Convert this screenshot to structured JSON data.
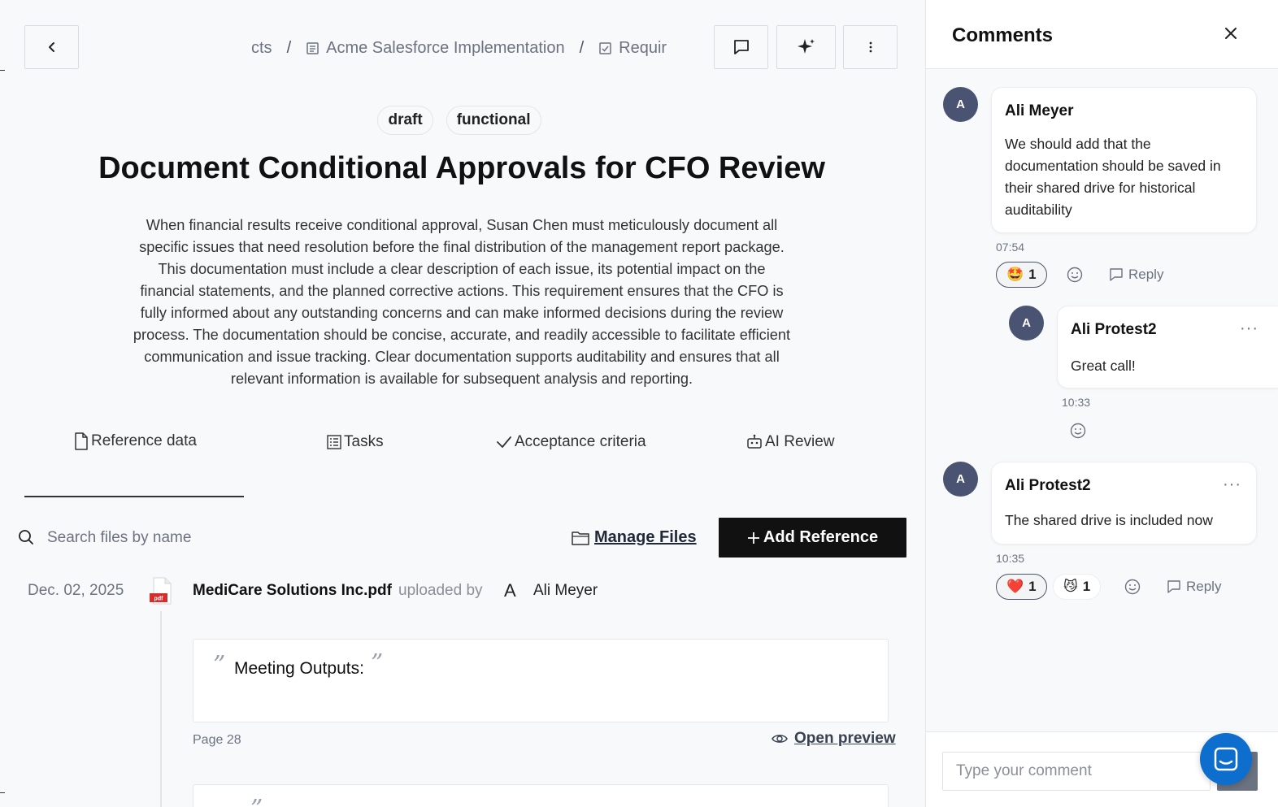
{
  "breadcrumb": {
    "items": [
      "cts",
      "Acme Salesforce Implementation",
      "Requir"
    ],
    "separator": "/"
  },
  "tags": [
    "draft",
    "functional"
  ],
  "requirement": {
    "title": "Document Conditional Approvals for CFO Review",
    "description": "When financial results receive conditional approval, Susan Chen must meticulously document all specific issues that need resolution before the final distribution of the management report package. This documentation must include a clear description of each issue, its potential impact on the financial statements, and the planned corrective actions. This requirement ensures that the CFO is fully informed about any outstanding concerns and can make informed decisions during the review process. The documentation should be concise, accurate, and readily accessible to facilitate efficient communication and issue tracking. Clear documentation supports auditability and ensures that all relevant information is available for subsequent analysis and reporting."
  },
  "tabs": {
    "reference": "Reference data",
    "tasks": "Tasks",
    "acceptance": "Acceptance criteria",
    "ai_review": "AI Review",
    "active": "reference"
  },
  "files": {
    "search_placeholder": "Search files by name",
    "manage_label": "Manage Files",
    "add_label": "Add Reference",
    "entry": {
      "date": "Dec. 02, 2025",
      "icon_label": "pdf",
      "name": "MediCare Solutions Inc.pdf",
      "uploaded_by_label": "uploaded by",
      "uploader_initial": "A",
      "uploader_name": "Ali Meyer"
    },
    "quote": {
      "open_mark": "”",
      "close_mark": "”",
      "text": "Meeting Outputs:",
      "page": "Page 28",
      "preview_label": "Open preview"
    }
  },
  "comments_panel": {
    "title": "Comments",
    "input_placeholder": "Type your comment",
    "reply_label": "Reply",
    "comments": [
      {
        "initial": "A",
        "author": "Ali Meyer",
        "text": "We should add that the documentation should be saved in their shared drive for historical auditability",
        "time": "07:54",
        "reactions": [
          {
            "emoji": "🤩",
            "count": "1"
          }
        ]
      },
      {
        "initial": "A",
        "author": "Ali Protest2",
        "text": "Great call!",
        "time": "10:33",
        "reactions": []
      },
      {
        "initial": "A",
        "author": "Ali Protest2",
        "text": "The shared drive is included now",
        "time": "10:35",
        "reactions": [
          {
            "emoji": "❤️",
            "count": "1"
          },
          {
            "emoji": "😼",
            "count": "1"
          }
        ]
      }
    ]
  },
  "colors": {
    "primary_button": "#111111",
    "avatar": "#4a5372",
    "chat_launcher": "#0d6ece"
  },
  "icons": {
    "back": "chevron-left-icon",
    "comments": "chat-bubble-icon",
    "ai": "sparkle-icon",
    "more": "vertical-dots-icon",
    "close": "close-icon",
    "search": "search-icon",
    "folder": "folder-icon",
    "plus": "plus-icon",
    "file": "pdf-file-icon",
    "eye": "eye-icon",
    "emoji": "smiley-icon",
    "reply": "reply-icon",
    "launcher": "chat-launcher-icon"
  }
}
